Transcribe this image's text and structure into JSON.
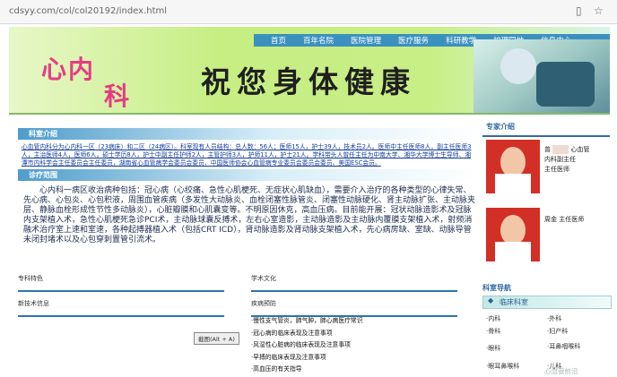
{
  "address_bar": {
    "url": "cdsyy.com/col/col20192/index.html"
  },
  "nav": [
    "首页",
    "百年名院",
    "医院管理",
    "医疗服务",
    "科研教学",
    "护理园地",
    "信息中心"
  ],
  "logo": {
    "title_top": "心内",
    "title_bottom": "科"
  },
  "banner": {
    "slogan": "祝您身体健康"
  },
  "sections": {
    "intro_title": "科室介绍",
    "intro_text": "心血管内科分为心内科一区（23病床）和二区（24病区）。科室现有人员结构：总人数：56人；医师15人，护士39人，技术员2人。医师中主任医师8人，副主任医师3人，主治医师4人，医师6人，硕士学历8人，护士中副主任护师2人，主管护师3人，护师11人，护士21人。学科带头人曾任主任为中南大学、湘华大学博士生导师、湘潭市内科学会主任委员会主任委员，湖南省心血管病学会委员会委员、中国医师协会心血管病专业委员会委员会委员、美国ESC会员。",
    "treat_title": "诊疗范围",
    "treat_text": "心内科一病区收治病种包括：冠心病（心绞痛、急性心肌梗死、无症状心肌缺血），需要介入治疗的各种类型的心律失常、先心病、心包炎、心包积液，周围血管疾病（多发性大动脉炎、血栓闭塞性脉管炎、闭塞性动脉硬化、肾主动脉扩张、主动脉夹层、静脉血栓形成性节性多动脉炎），心脏瓣膜和心肌囊变等。不明原因休克，高血压病。目前能开展：冠状动脉造影术及冠脉内支架植入术，急性心肌梗死急诊PCI术，主动脉球囊反搏术，左右心室造影，主动脉造影及主动脉内覆膜支架植入术，射频消融术治疗室上速和室速，各种起搏器植入术（包括CRT ICD），肾动脉造影及肾动脉支架植入术，先心病房缺、室缺、动脉导管未闭封堵术以及心包穿刺置管引流术。"
  },
  "bottom_boxes": {
    "specialty": "专科特色",
    "academic": "学术文化",
    "new_tech": "新技术信息",
    "prevention": "疾病预防"
  },
  "prevention_list": [
    "·慢性支气管炎，肺气肿，肺心病医疗常识",
    "·冠心病的临床表现及注意事项",
    "·风湿性心脏病的临床表现及注意事项",
    "·早搏的临床表现及注意事项",
    "·高血压的有关指导"
  ],
  "tooltip": "截图(Alt + A)",
  "right": {
    "experts_title": "专家介绍",
    "doctor1_lines": [
      "曾",
      "心血管",
      "内科副主任",
      "主任医师"
    ],
    "doctor2_lines": [
      "周金 主任医师"
    ],
    "nav_title": "科室导航",
    "clinic_title": "临床科室",
    "links": [
      "·内科",
      "·骨科",
      "·眼科",
      "·眼耳鼻喉科",
      "·外科",
      "·妇产科",
      "·耳鼻咽喉科",
      "·儿科"
    ]
  },
  "watermark": "心血管前沿"
}
